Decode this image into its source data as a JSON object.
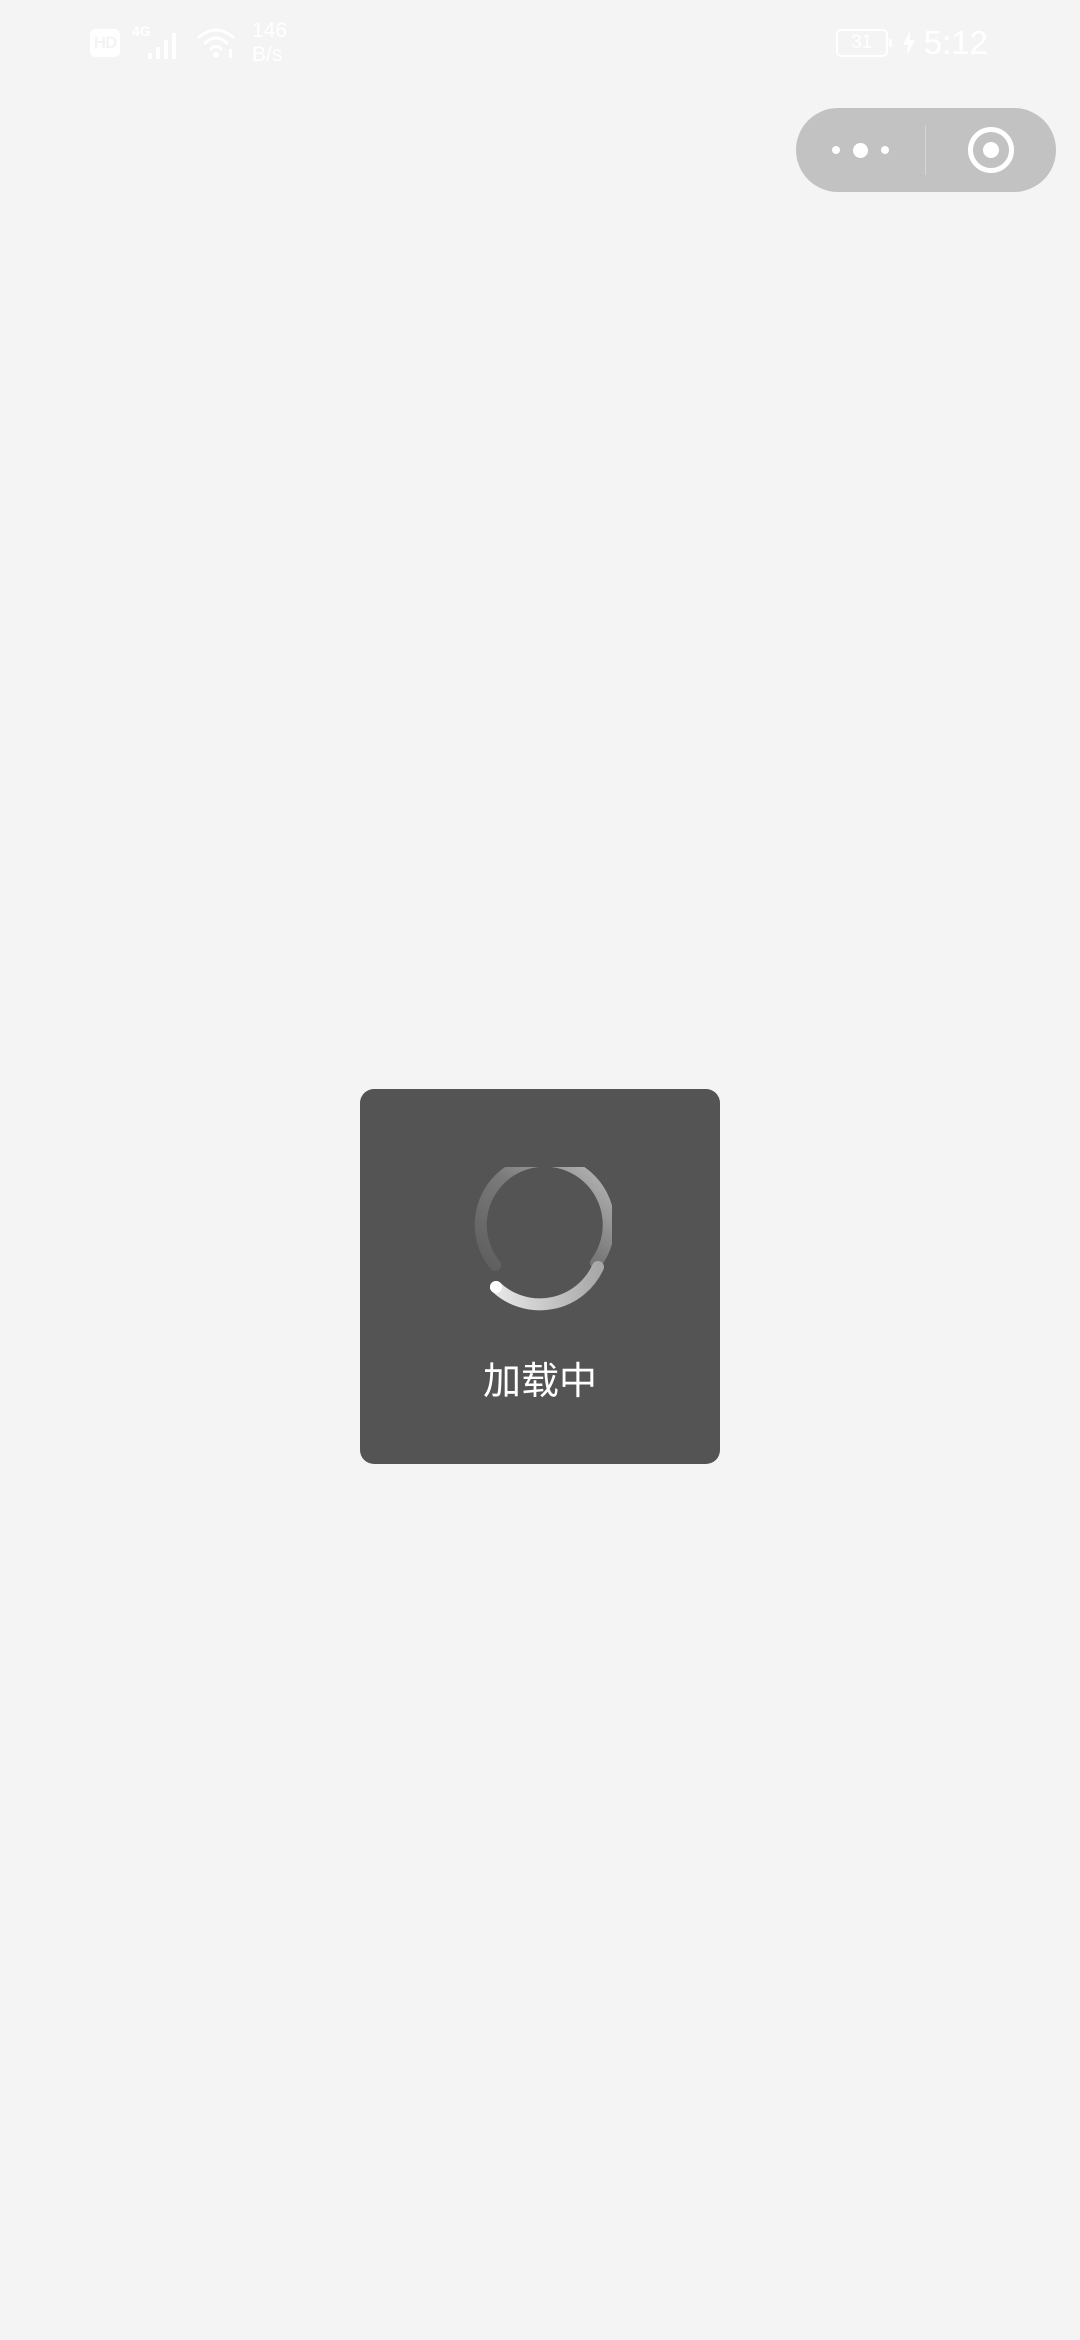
{
  "status_bar": {
    "hd_badge": "HD",
    "network_type": "4G",
    "net_speed_value": "146",
    "net_speed_unit": "B/s",
    "battery_level": "31",
    "time": "5:12",
    "icons": [
      "hd-icon",
      "signal-icon",
      "wifi-icon",
      "battery-icon",
      "charging-icon"
    ]
  },
  "capsule": {
    "icons": [
      "more-dots-icon",
      "close-target-icon"
    ]
  },
  "loading_toast": {
    "label": "加载中",
    "icon": "spinner-icon"
  },
  "colors": {
    "background": "#f4f4f4",
    "toast_background": "#545454",
    "capsule_background": "#c2c2c2",
    "text_light": "#ffffff"
  }
}
